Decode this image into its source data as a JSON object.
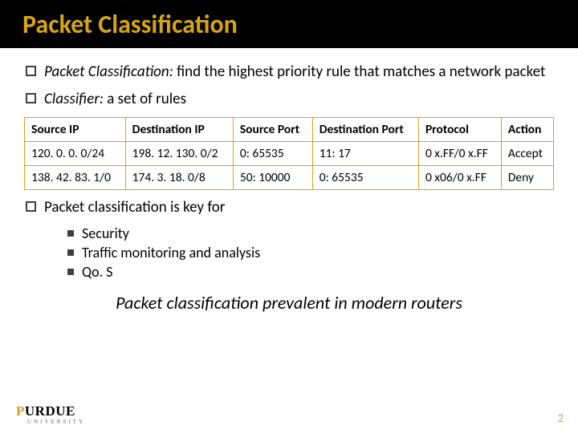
{
  "title": "Packet Classification",
  "bullets": [
    {
      "term": "Packet Classification:",
      "rest": " find the highest priority rule that matches a network packet"
    },
    {
      "term": "Classifier:",
      "rest": " a set of rules"
    }
  ],
  "table": {
    "headers": [
      "Source IP",
      "Destination IP",
      "Source Port",
      "Destination Port",
      "Protocol",
      "Action"
    ],
    "rows": [
      [
        "120. 0. 0. 0/24",
        "198. 12. 130. 0/2",
        "0: 65535",
        "11: 17",
        "0 x.FF/0 x.FF",
        "Accept"
      ],
      [
        "138. 42. 83. 1/0",
        "174. 3. 18. 0/8",
        "50: 10000",
        "0: 65535",
        "0 x06/0 x.FF",
        "Deny"
      ]
    ]
  },
  "bullet3": "Packet classification is key for",
  "subbullets": [
    "Security",
    "Traffic monitoring and analysis",
    "Qo. S"
  ],
  "closing": "Packet classification prevalent in modern routers",
  "logo": {
    "p": "P",
    "rest": "URDUE",
    "uni": "UNIVERSITY"
  },
  "pagenum": "2"
}
